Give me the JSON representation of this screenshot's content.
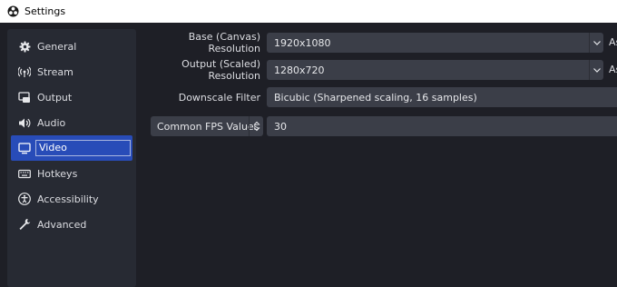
{
  "window": {
    "title": "Settings"
  },
  "sidebar": {
    "items": [
      {
        "label": "General",
        "icon": "gear-icon"
      },
      {
        "label": "Stream",
        "icon": "broadcast-icon"
      },
      {
        "label": "Output",
        "icon": "output-icon"
      },
      {
        "label": "Audio",
        "icon": "speaker-icon"
      },
      {
        "label": "Video",
        "icon": "monitor-icon",
        "active": true
      },
      {
        "label": "Hotkeys",
        "icon": "keyboard-icon"
      },
      {
        "label": "Accessibility",
        "icon": "accessibility-icon"
      },
      {
        "label": "Advanced",
        "icon": "wrench-icon"
      }
    ]
  },
  "video": {
    "base_resolution": {
      "label": "Base (Canvas) Resolution",
      "value": "1920x1080",
      "aspect_prefix": "As"
    },
    "output_resolution": {
      "label": "Output (Scaled) Resolution",
      "value": "1280x720",
      "aspect_prefix": "As"
    },
    "downscale_filter": {
      "label": "Downscale Filter",
      "value": "Bicubic (Sharpened scaling, 16 samples)"
    },
    "fps": {
      "mode": "Common FPS Values",
      "value": "30"
    }
  },
  "colors": {
    "accent": "#284cb8",
    "background": "#1e1f26",
    "sidebar": "#272a33",
    "field": "#3b3e48"
  }
}
